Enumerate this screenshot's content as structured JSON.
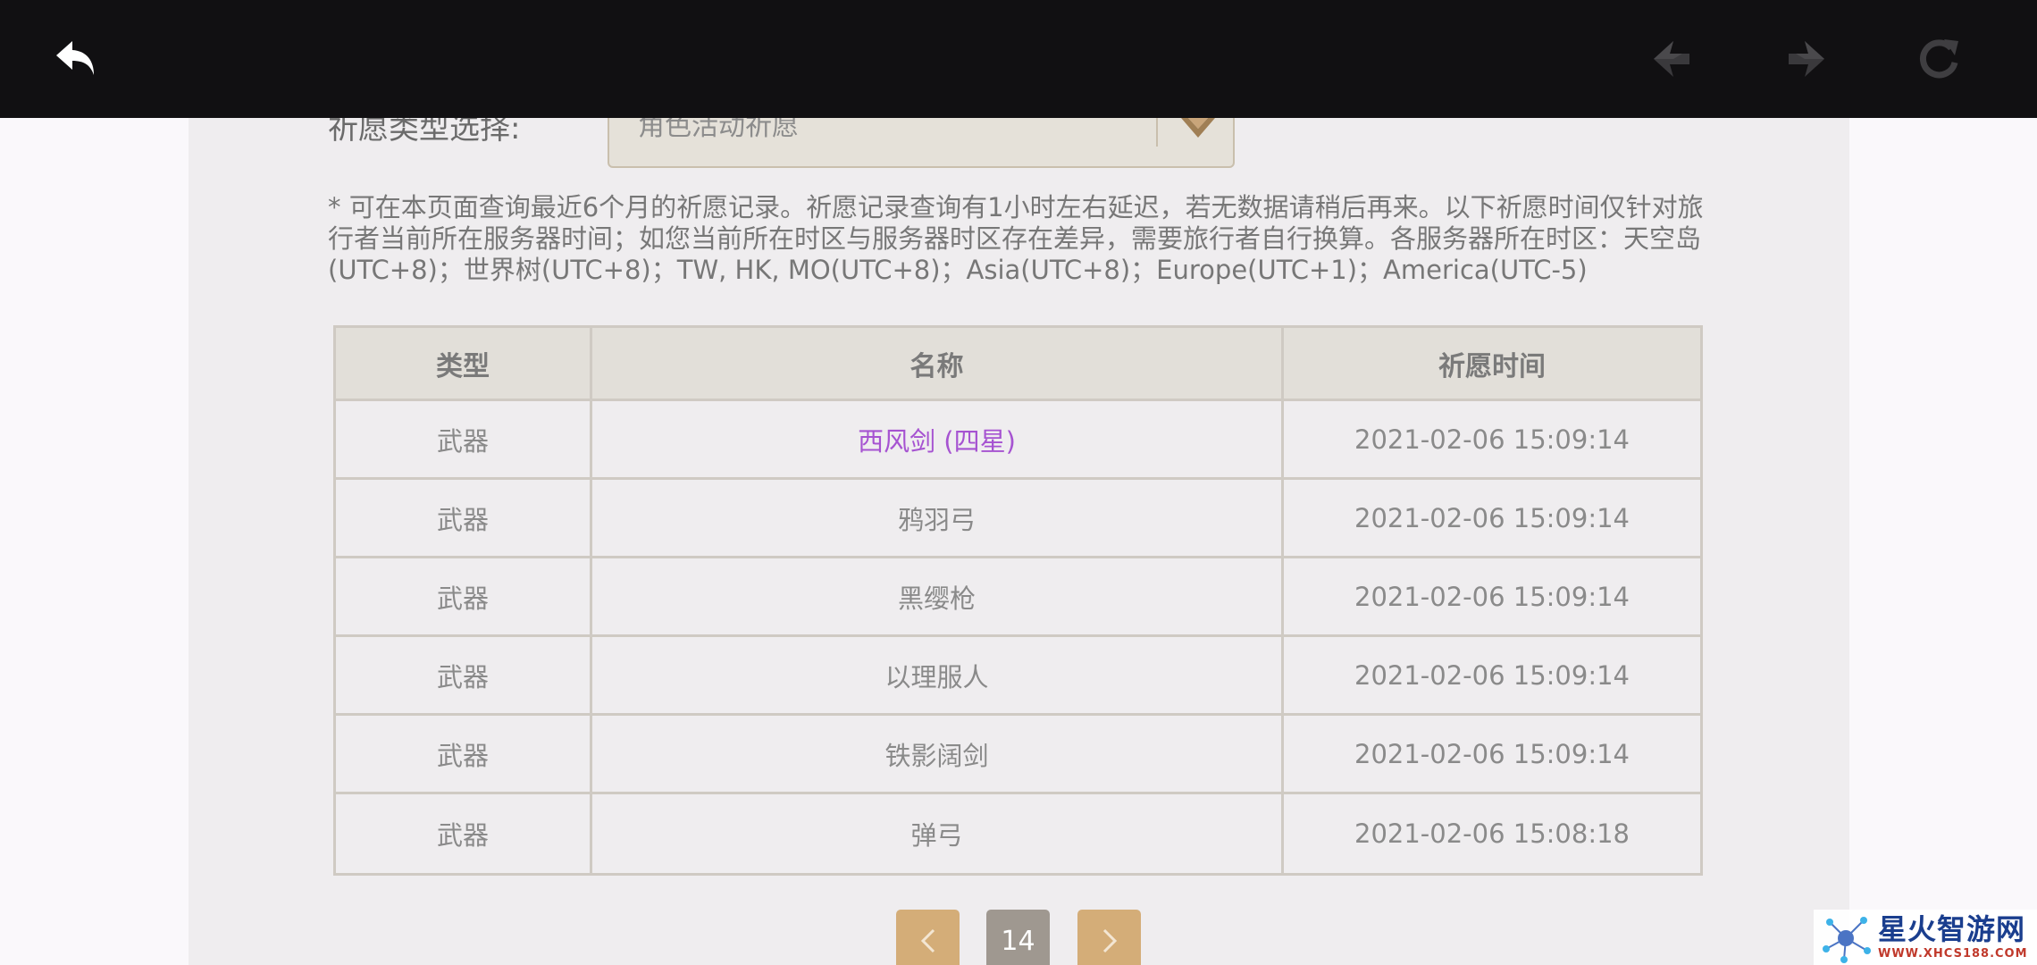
{
  "filter": {
    "label": "祈愿类型选择:",
    "selected": "角色活动祈愿"
  },
  "note": "* 可在本页面查询最近6个月的祈愿记录。祈愿记录查询有1小时左右延迟，若无数据请稍后再来。以下祈愿时间仅针对旅行者当前所在服务器时间；如您当前所在时区与服务器时区存在差异，需要旅行者自行换算。各服务器所在时区：天空岛(UTC+8)；世界树(UTC+8)；TW, HK, MO(UTC+8)；Asia(UTC+8)；Europe(UTC+1)；America(UTC-5)",
  "table": {
    "headers": [
      "类型",
      "名称",
      "祈愿时间"
    ],
    "rows": [
      {
        "type": "武器",
        "name": "西风剑 (四星)",
        "time": "2021-02-06 15:09:14"
      },
      {
        "type": "武器",
        "name": "鸦羽弓",
        "time": "2021-02-06 15:09:14"
      },
      {
        "type": "武器",
        "name": "黑缨枪",
        "time": "2021-02-06 15:09:14"
      },
      {
        "type": "武器",
        "name": "以理服人",
        "time": "2021-02-06 15:09:14"
      },
      {
        "type": "武器",
        "name": "铁影阔剑",
        "time": "2021-02-06 15:09:14"
      },
      {
        "type": "武器",
        "name": "弹弓",
        "time": "2021-02-06 15:08:18"
      }
    ]
  },
  "pagination": {
    "current_page": "14"
  },
  "watermark": {
    "title": "星火智游网",
    "url": "WWW.XHCS188.COM"
  },
  "colors": {
    "topbar": "#111012",
    "panel": "#efedef",
    "accent_gold": "#d4ad78",
    "four_star_purple": "#a653d1"
  },
  "icons": {
    "back": "back-arrow-icon",
    "prev": "diamond-left-icon",
    "next": "diamond-right-icon",
    "refresh": "refresh-icon"
  }
}
